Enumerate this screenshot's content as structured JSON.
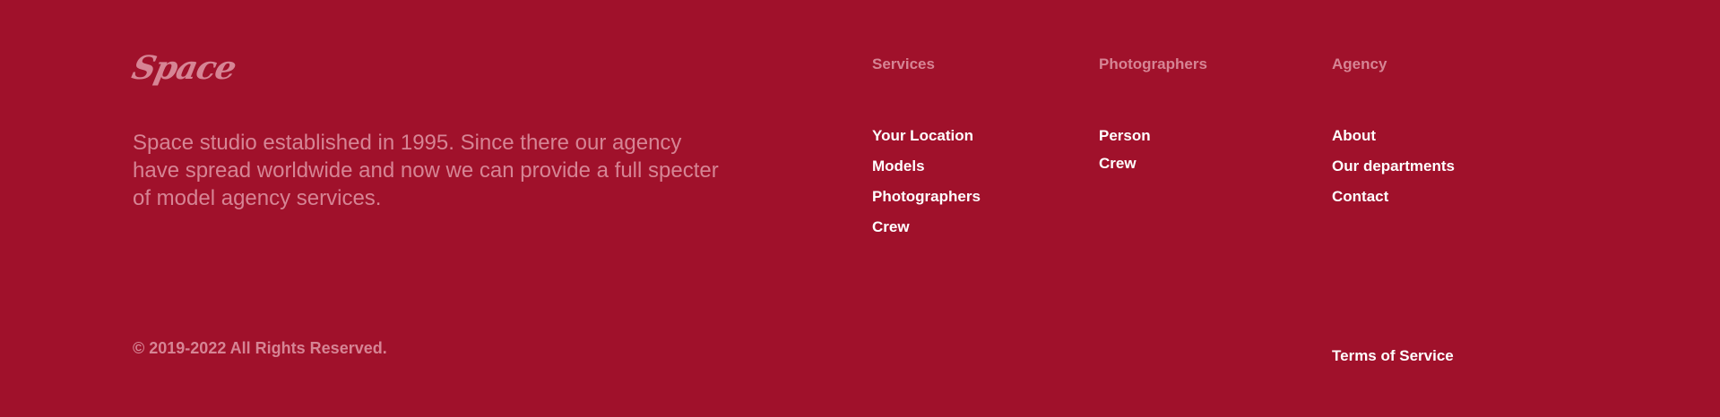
{
  "brand": {
    "logo_text": "Space"
  },
  "about": {
    "text": "Space studio established in 1995. Since there our agency have spread worldwide and now we can provide a full specter of model agency services."
  },
  "copyright": "© 2019-2022 All Rights Reserved.",
  "columns": [
    {
      "heading": "Services",
      "links": [
        "Your Location",
        "Models",
        "Photographers",
        "Crew"
      ]
    },
    {
      "heading": "Photographers",
      "links": [
        "Person",
        "Crew"
      ]
    },
    {
      "heading": "Agency",
      "links": [
        "About",
        "Our departments",
        "Contact"
      ]
    }
  ],
  "terms_label": "Terms of Service",
  "colors": {
    "background": "#a0112b",
    "muted": "#d68494",
    "link": "#ffffff"
  }
}
